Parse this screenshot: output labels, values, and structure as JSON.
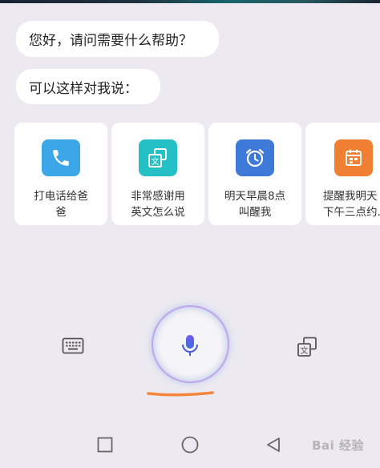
{
  "conversation": {
    "greeting": "您好，请问需要什么帮助？",
    "prompt": "可以这样对我说："
  },
  "suggestions": [
    {
      "label_line1": "打电话给爸",
      "label_line2": "爸",
      "icon": "phone-icon",
      "color": "#3ba6e8"
    },
    {
      "label_line1": "非常感谢用",
      "label_line2": "英文怎么说",
      "icon": "translate-icon",
      "color": "#25bfc6"
    },
    {
      "label_line1": "明天早晨8点",
      "label_line2": "叫醒我",
      "icon": "alarm-clock-icon",
      "color": "#3f79d8"
    },
    {
      "label_line1": "提醒我明天",
      "label_line2": "下午三点约...",
      "icon": "calendar-icon",
      "color": "#f07e33"
    }
  ],
  "controls": {
    "keyboard": "keyboard-icon",
    "mic": "microphone-icon",
    "translate": "translate-icon",
    "mic_color": "#4a5de0",
    "underline_color": "#f4853b"
  },
  "navbar": {
    "recent": "square-icon",
    "home": "circle-icon",
    "back": "triangle-back-icon"
  },
  "watermark": {
    "text": "Bai 经验"
  }
}
